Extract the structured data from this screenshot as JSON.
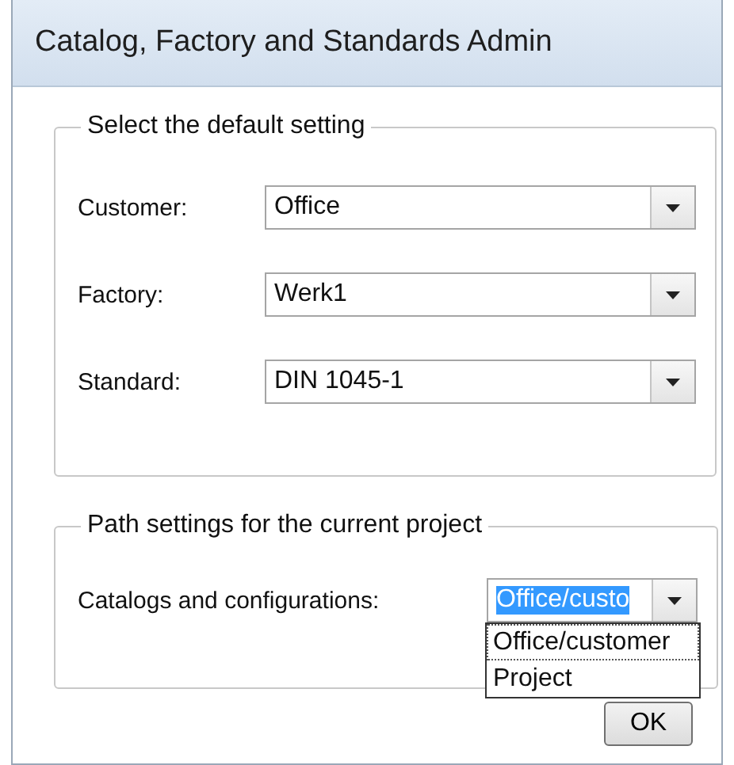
{
  "window": {
    "title": "Catalog, Factory and Standards Admin"
  },
  "default_group": {
    "legend": "Select the default setting",
    "fields": [
      {
        "label": "Customer:",
        "value": "Office"
      },
      {
        "label": "Factory:",
        "value": "Werk1"
      },
      {
        "label": "Standard:",
        "value": "DIN 1045-1"
      }
    ]
  },
  "path_group": {
    "legend": "Path settings for the current project",
    "field": {
      "label": "Catalogs and configurations:",
      "value": "Office/custo",
      "text_selected": true,
      "expanded": true,
      "options": [
        {
          "label": "Office/customer",
          "selected": true
        },
        {
          "label": "Project",
          "selected": false
        }
      ]
    }
  },
  "buttons": [
    "OK"
  ]
}
